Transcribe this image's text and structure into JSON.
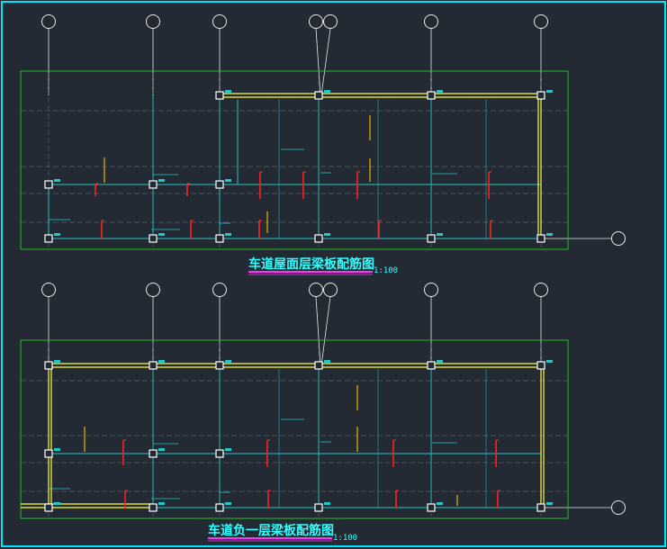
{
  "colors": {
    "background": "#232a33",
    "frame": "#00e5ff",
    "outline": "#1fbf1f",
    "beam_main": "#ffff33",
    "beam_secondary": "#24c6c6",
    "rebar_red": "#ff2020",
    "rebar_yellow": "#e6b800",
    "axis": "#e8e8e8",
    "title_cyan": "#30ffff",
    "title_underline": "#ff33ff",
    "grid_grey": "#6a727c"
  },
  "drawings": [
    {
      "title": "车道屋面层梁板配筋图",
      "scale": "1:100"
    },
    {
      "title": "车道负一层梁板配筋图",
      "scale": "1:100"
    }
  ]
}
